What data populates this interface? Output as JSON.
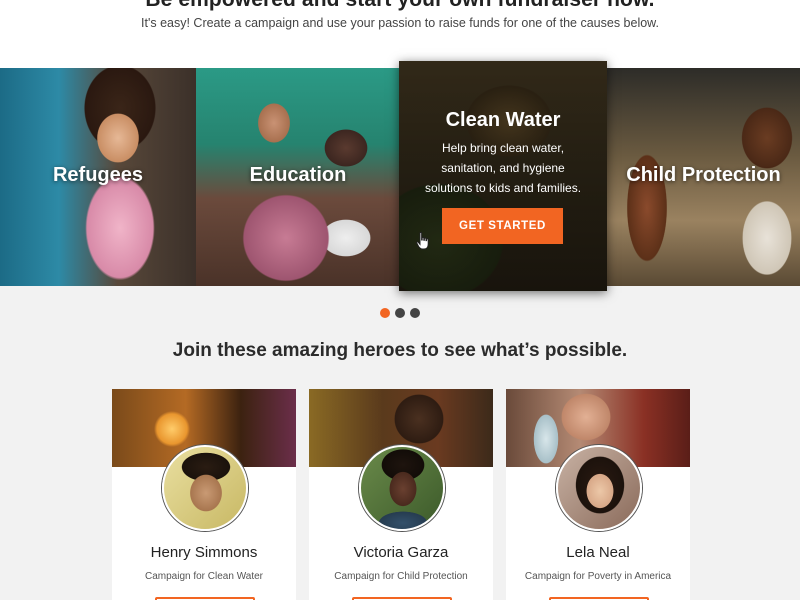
{
  "hero": {
    "title": "Be empowered and start your own fundraiser now.",
    "subtitle": "It's easy! Create a campaign and use your passion to raise funds for one of the causes below."
  },
  "causes": [
    {
      "label": "Refugees"
    },
    {
      "label": "Education"
    },
    {
      "label": "Clean Water",
      "description": "Help bring clean water, sanitation, and hygiene solutions to kids and families.",
      "cta": "GET STARTED",
      "active": true
    },
    {
      "label": "Child Protection"
    }
  ],
  "carousel": {
    "pages": 3,
    "active_page": 1
  },
  "colors": {
    "accent": "#f26522",
    "dot_inactive": "#444444"
  },
  "heroes_section": {
    "title": "Join these amazing heroes to see what’s possible."
  },
  "campaigners": [
    {
      "name": "Henry Simmons",
      "campaign": "Campaign for Clean Water"
    },
    {
      "name": "Victoria Garza",
      "campaign": "Campaign for Child Protection"
    },
    {
      "name": "Lela Neal",
      "campaign": "Campaign for Poverty in America"
    }
  ]
}
